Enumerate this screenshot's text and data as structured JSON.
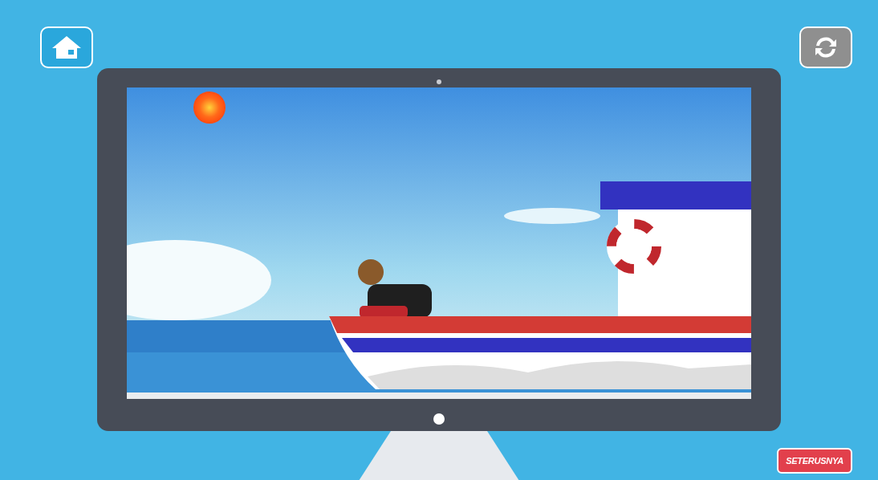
{
  "home_button": {
    "disabled": false
  },
  "replay_button": {
    "disabled": true
  },
  "next_button": {
    "label": "SETERUSNYA"
  }
}
